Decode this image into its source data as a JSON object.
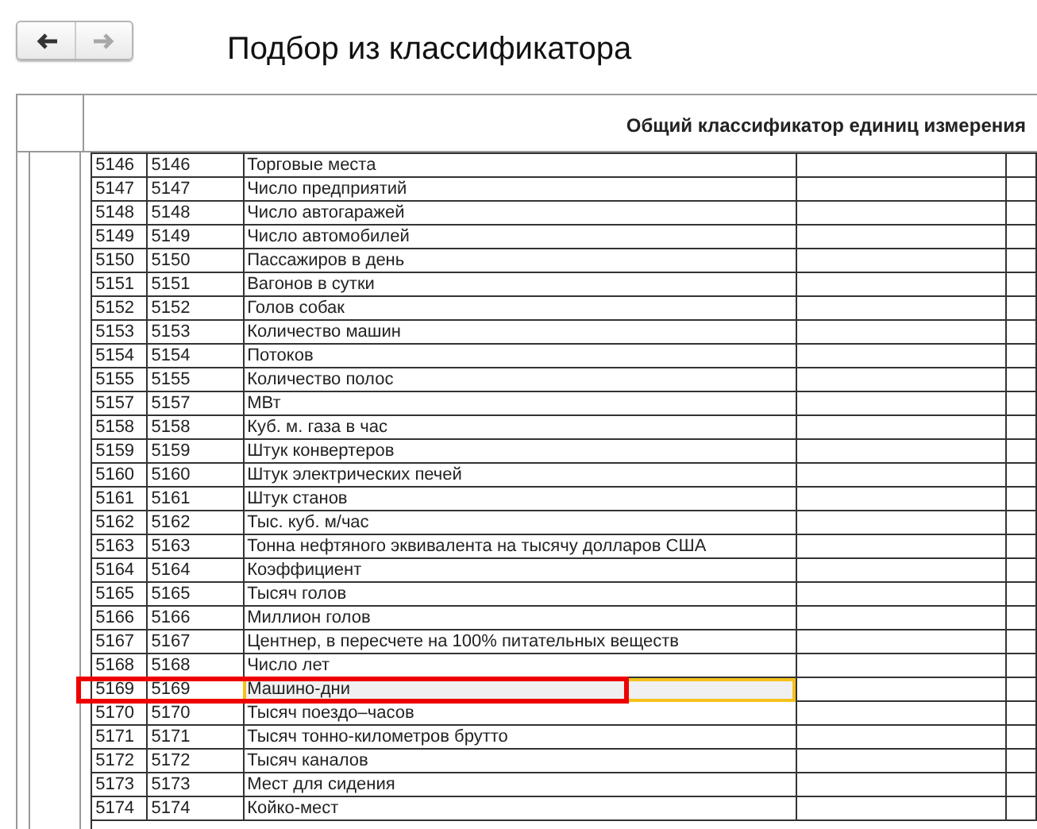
{
  "toolbar": {
    "buttons": [
      {
        "kind": "back",
        "disabled": false
      },
      {
        "kind": "forward",
        "disabled": true
      }
    ]
  },
  "title": "Подбор из классификатора",
  "table": {
    "header": "Общий классификатор единиц измерения",
    "rows": [
      {
        "code": "5146",
        "code_2": "5146",
        "name": "Торговые места",
        "selected": false,
        "annotated": false
      },
      {
        "code": "5147",
        "code_2": "5147",
        "name": "Число предприятий",
        "selected": false,
        "annotated": false
      },
      {
        "code": "5148",
        "code_2": "5148",
        "name": "Число автогаражей",
        "selected": false,
        "annotated": false
      },
      {
        "code": "5149",
        "code_2": "5149",
        "name": "Число автомобилей",
        "selected": false,
        "annotated": false
      },
      {
        "code": "5150",
        "code_2": "5150",
        "name": "Пассажиров в день",
        "selected": false,
        "annotated": false
      },
      {
        "code": "5151",
        "code_2": "5151",
        "name": "Вагонов в сутки",
        "selected": false,
        "annotated": false
      },
      {
        "code": "5152",
        "code_2": "5152",
        "name": "Голов собак",
        "selected": false,
        "annotated": false
      },
      {
        "code": "5153",
        "code_2": "5153",
        "name": "Количество машин",
        "selected": false,
        "annotated": false
      },
      {
        "code": "5154",
        "code_2": "5154",
        "name": "Потоков",
        "selected": false,
        "annotated": false
      },
      {
        "code": "5155",
        "code_2": "5155",
        "name": "Количество полос",
        "selected": false,
        "annotated": false
      },
      {
        "code": "5157",
        "code_2": "5157",
        "name": "МВт",
        "selected": false,
        "annotated": false
      },
      {
        "code": "5158",
        "code_2": "5158",
        "name": "Куб. м. газа в час",
        "selected": false,
        "annotated": false
      },
      {
        "code": "5159",
        "code_2": "5159",
        "name": "Штук конвертеров",
        "selected": false,
        "annotated": false
      },
      {
        "code": "5160",
        "code_2": "5160",
        "name": "Штук электрических печей",
        "selected": false,
        "annotated": false
      },
      {
        "code": "5161",
        "code_2": "5161",
        "name": "Штук станов",
        "selected": false,
        "annotated": false
      },
      {
        "code": "5162",
        "code_2": "5162",
        "name": "Тыс. куб. м/час",
        "selected": false,
        "annotated": false
      },
      {
        "code": "5163",
        "code_2": "5163",
        "name": "Тонна нефтяного эквивалента на тысячу долларов США",
        "selected": false,
        "annotated": false
      },
      {
        "code": "5164",
        "code_2": "5164",
        "name": "Коэффициент",
        "selected": false,
        "annotated": false
      },
      {
        "code": "5165",
        "code_2": "5165",
        "name": "Тысяч голов",
        "selected": false,
        "annotated": false
      },
      {
        "code": "5166",
        "code_2": "5166",
        "name": "Миллион голов",
        "selected": false,
        "annotated": false
      },
      {
        "code": "5167",
        "code_2": "5167",
        "name": "Центнер, в пересчете на 100% питательных веществ",
        "selected": false,
        "annotated": false
      },
      {
        "code": "5168",
        "code_2": "5168",
        "name": "Число лет",
        "selected": false,
        "annotated": false
      },
      {
        "code": "5169",
        "code_2": "5169",
        "name": "Машино-дни",
        "selected": true,
        "annotated": true
      },
      {
        "code": "5170",
        "code_2": "5170",
        "name": "Тысяч поездо–часов",
        "selected": false,
        "annotated": false
      },
      {
        "code": "5171",
        "code_2": "5171",
        "name": "Тысяч тонно-километров брутто",
        "selected": false,
        "annotated": false
      },
      {
        "code": "5172",
        "code_2": "5172",
        "name": "Тысяч каналов",
        "selected": false,
        "annotated": false
      },
      {
        "code": "5173",
        "code_2": "5173",
        "name": "Мест для сидения",
        "selected": false,
        "annotated": false
      },
      {
        "code": "5174",
        "code_2": "5174",
        "name": "Койко-мест",
        "selected": false,
        "annotated": false
      }
    ]
  }
}
